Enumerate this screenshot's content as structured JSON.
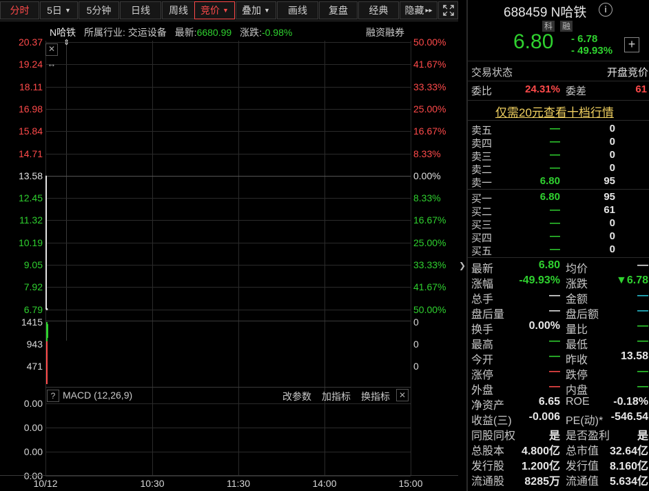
{
  "toolbar": {
    "items": [
      {
        "label": "分时",
        "caret": false,
        "active": false,
        "highlight": true
      },
      {
        "label": "5日",
        "caret": true
      },
      {
        "label": "5分钟",
        "caret": false
      },
      {
        "label": "日线",
        "caret": false
      },
      {
        "label": "周线",
        "caret": false
      },
      {
        "label": "竞价",
        "caret": true,
        "active": true
      },
      {
        "label": "叠加",
        "caret": true
      },
      {
        "label": "画线",
        "caret": false
      },
      {
        "label": "复盘",
        "caret": false
      },
      {
        "label": "经典",
        "caret": false
      },
      {
        "label": "隐藏",
        "caret": false
      }
    ],
    "hide_arrows": "▸▸"
  },
  "chart": {
    "stock_name": "N哈铁",
    "industry_label": "所属行业:",
    "industry_value": "交运设备",
    "latest_label": "最新:",
    "latest_value": "6680.99",
    "change_label": "涨跌:",
    "change_value": "-0.98%",
    "margin_label": "融资融券",
    "price_ticks": [
      "20.37",
      "19.24",
      "18.11",
      "16.98",
      "15.84",
      "14.71",
      "13.58",
      "12.45",
      "11.32",
      "10.19",
      "9.05",
      "7.92",
      "6.79"
    ],
    "pct_ticks": [
      "50.00%",
      "41.67%",
      "33.33%",
      "25.00%",
      "16.67%",
      "8.33%",
      "0.00%",
      "8.33%",
      "16.67%",
      "25.00%",
      "33.33%",
      "41.67%",
      "50.00%"
    ],
    "volume_ticks": [
      "1415",
      "943",
      "471"
    ],
    "volume_right_ticks": [
      "0",
      "0",
      "0"
    ],
    "macd_title": "MACD (12,26,9)",
    "macd_buttons": [
      "改参数",
      "加指标",
      "换指标"
    ],
    "macd_ticks": [
      "0.00",
      "0.00",
      "0.00",
      "0.00"
    ],
    "time_ticks": [
      "10/12",
      "10:30",
      "11:30",
      "14:00",
      "15:00"
    ],
    "question_mark": "?"
  },
  "chart_data": {
    "type": "line",
    "x": [
      "09:25"
    ],
    "series": [
      {
        "values": [
          6.8
        ]
      }
    ],
    "ylim": [
      6.79,
      20.37
    ],
    "reference": 13.58
  },
  "quote": {
    "code_name": "688459 N哈铁",
    "tags": [
      "科",
      "融"
    ],
    "price": "6.80",
    "change": "- 6.78",
    "change_pct": "- 49.93%",
    "status_label": "交易状态",
    "status_value": "开盘竞价",
    "ratio_label": "委比",
    "ratio_value": "24.31%",
    "diff_label": "委差",
    "diff_value": "61",
    "promo": "仅需20元查看十档行情"
  },
  "order_book": {
    "asks": [
      {
        "label": "卖五",
        "price": "—",
        "vol": "0"
      },
      {
        "label": "卖四",
        "price": "—",
        "vol": "0"
      },
      {
        "label": "卖三",
        "price": "—",
        "vol": "0"
      },
      {
        "label": "卖二",
        "price": "—",
        "vol": "0"
      },
      {
        "label": "卖一",
        "price": "6.80",
        "vol": "95"
      }
    ],
    "bids": [
      {
        "label": "买一",
        "price": "6.80",
        "vol": "95"
      },
      {
        "label": "买二",
        "price": "—",
        "vol": "61"
      },
      {
        "label": "买三",
        "price": "—",
        "vol": "0"
      },
      {
        "label": "买四",
        "price": "—",
        "vol": "0"
      },
      {
        "label": "买五",
        "price": "—",
        "vol": "0"
      }
    ]
  },
  "stats": [
    {
      "l1": "最新",
      "v1": "6.80",
      "c1": "green",
      "l2": "均价",
      "v2": "—",
      "c2": "white"
    },
    {
      "l1": "涨幅",
      "v1": "-49.93%",
      "c1": "green",
      "l2": "涨跌",
      "v2": "▼6.78",
      "c2": "green"
    },
    {
      "l1": "总手",
      "v1": "—",
      "c1": "white",
      "l2": "金额",
      "v2": "—",
      "c2": "cyan"
    },
    {
      "l1": "盘后量",
      "v1": "—",
      "c1": "white",
      "l2": "盘后额",
      "v2": "—",
      "c2": "cyan"
    },
    {
      "l1": "换手",
      "v1": "0.00%",
      "c1": "white",
      "l2": "量比",
      "v2": "—",
      "c2": "green"
    },
    {
      "l1": "最高",
      "v1": "—",
      "c1": "green",
      "l2": "最低",
      "v2": "—",
      "c2": "green"
    },
    {
      "l1": "今开",
      "v1": "—",
      "c1": "green",
      "l2": "昨收",
      "v2": "13.58",
      "c2": "white"
    },
    {
      "l1": "涨停",
      "v1": "—",
      "c1": "red",
      "l2": "跌停",
      "v2": "—",
      "c2": "green"
    },
    {
      "l1": "外盘",
      "v1": "—",
      "c1": "red",
      "l2": "内盘",
      "v2": "—",
      "c2": "green"
    },
    {
      "l1": "净资产",
      "v1": "6.65",
      "c1": "white",
      "l2": "ROE",
      "v2": "-0.18%",
      "c2": "white"
    },
    {
      "l1": "收益(三)",
      "v1": "-0.006",
      "c1": "white",
      "l2": "PE(动)*",
      "v2": "-546.54",
      "c2": "white"
    },
    {
      "l1": "同股同权",
      "v1": "是",
      "c1": "white",
      "l2": "是否盈利",
      "v2": "是",
      "c2": "white"
    },
    {
      "l1": "总股本",
      "v1": "4.800亿",
      "c1": "white",
      "l2": "总市值",
      "v2": "32.64亿",
      "c2": "white"
    },
    {
      "l1": "发行股",
      "v1": "1.200亿",
      "c1": "white",
      "l2": "发行值",
      "v2": "8.160亿",
      "c2": "white"
    },
    {
      "l1": "流通股",
      "v1": "8285万",
      "c1": "white",
      "l2": "流通值",
      "v2": "5.634亿",
      "c2": "white"
    }
  ],
  "colors": {
    "up": "#ff4a4a",
    "down": "#2fd12f",
    "accent": "#ff4a4a",
    "bg": "#000000",
    "grid": "#2b2b2b"
  }
}
